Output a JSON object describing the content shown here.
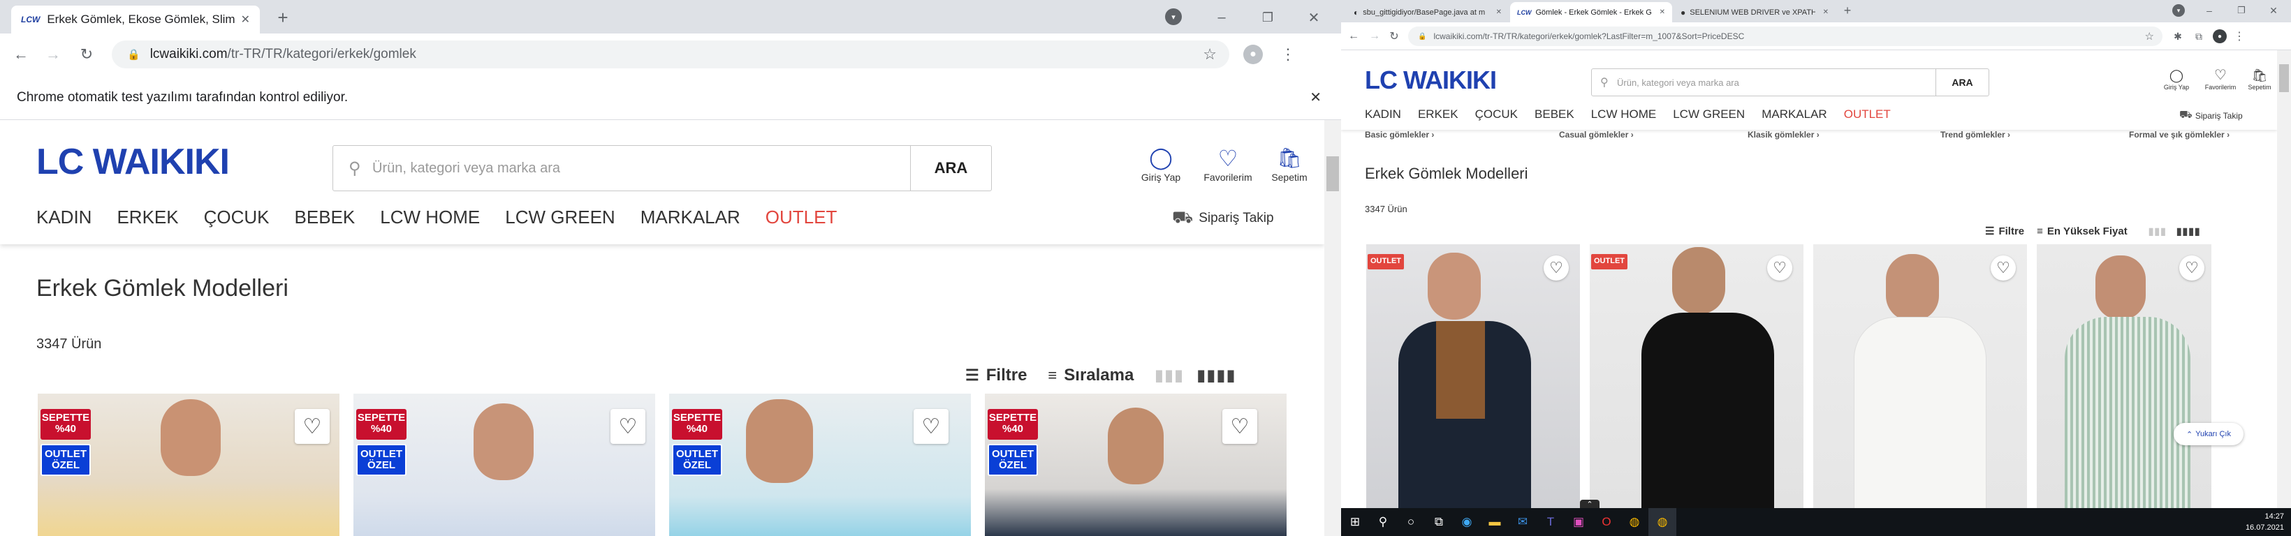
{
  "left": {
    "tab": {
      "favicon": "LCW",
      "title": "Erkek Gömlek, Ekose Gömlek, Slim Fit Gömlek Modelleri",
      "close": "✕"
    },
    "new_tab": "+",
    "url": {
      "host": "lcwaikiki.com",
      "path": "/tr-TR/TR/kategori/erkek/gomlek"
    },
    "infobar": "Chrome otomatik test yazılımı tarafından kontrol ediliyor.",
    "site": {
      "logo": "LC WAIKIKI",
      "search_placeholder": "Ürün, kategori veya marka ara",
      "search_button": "ARA",
      "login": "Giriş Yap",
      "favorites": "Favorilerim",
      "cart": "Sepetim",
      "nav": [
        "KADIN",
        "ERKEK",
        "ÇOCUK",
        "BEBEK",
        "LCW HOME",
        "LCW GREEN",
        "MARKALAR",
        "OUTLET"
      ],
      "order_track": "Sipariş Takip",
      "heading": "Erkek Gömlek Modelleri",
      "count": "3347 Ürün",
      "filter": "Filtre",
      "sort": "Sıralama",
      "badge_cart": "SEPETTE %40",
      "badge_outlet": "OUTLET ÖZEL"
    }
  },
  "right": {
    "tabs": [
      {
        "favicon": "GH",
        "title": "sbu_gittigidiyor/BasePage.java at m"
      },
      {
        "favicon": "LCW",
        "title": "Gömlek - Erkek Gömlek - Erkek G"
      },
      {
        "favicon": "S",
        "title": "SELENIUM WEB DRIVER ve XPATH"
      }
    ],
    "url": "lcwaikiki.com/tr-TR/TR/kategori/erkek/gomlek?LastFilter=m_1007&Sort=PriceDESC",
    "site": {
      "logo": "LC WAIKIKI",
      "search_placeholder": "Ürün, kategori veya marka ara",
      "search_button": "ARA",
      "login": "Giriş Yap",
      "favorites": "Favorilerim",
      "cart": "Sepetim",
      "nav": [
        "KADIN",
        "ERKEK",
        "ÇOCUK",
        "BEBEK",
        "LCW HOME",
        "LCW GREEN",
        "MARKALAR",
        "OUTLET"
      ],
      "order_track": "Sipariş Takip",
      "subcats": [
        "Basic gömlekler ›",
        "Casual gömlekler ›",
        "Klasik gömlekler ›",
        "Trend gömlekler ›",
        "Formal ve şık gömlekler ›"
      ],
      "heading": "Erkek Gömlek Modelleri",
      "count": "3347 Ürün",
      "filter": "Filtre",
      "sort": "En Yüksek Fiyat",
      "badge_outlet": "OUTLET",
      "to_top": "Yukarı Çık"
    }
  },
  "taskbar": {
    "time": "14:27",
    "date": "16.07.2021"
  },
  "colors": {
    "brand": "#1f41b0",
    "outlet": "#e2463e",
    "badge_red": "#c8102e",
    "badge_blue": "#0a3fd6"
  }
}
